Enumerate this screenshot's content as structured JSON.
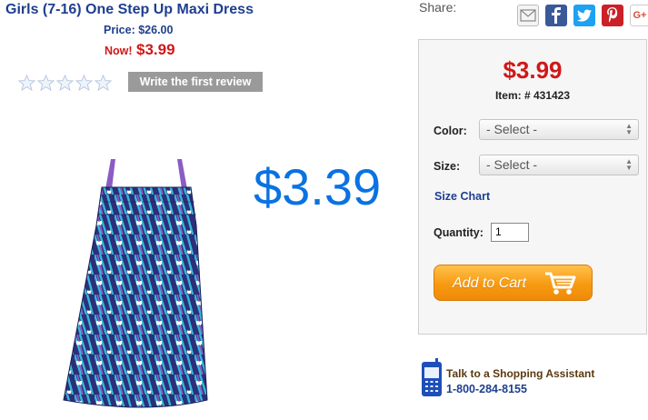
{
  "product": {
    "title": "Girls (7-16) One Step Up Maxi Dress",
    "price_label": "Price: $26.00",
    "now_label": "Now!",
    "now_price": "$3.99",
    "rating": 0,
    "review_button": "Write the first review",
    "overlay_price": "$3.39"
  },
  "share": {
    "label": "Share:",
    "icons": [
      "email-icon",
      "facebook-icon",
      "twitter-icon",
      "pinterest-icon",
      "google-plus-icon"
    ]
  },
  "panel": {
    "price": "$3.99",
    "item_number": "Item: # 431423",
    "color_label": "Color:",
    "color_value": "- Select -",
    "size_label": "Size:",
    "size_value": "- Select -",
    "size_chart": "Size Chart",
    "quantity_label": "Quantity:",
    "quantity_value": "1",
    "add_to_cart": "Add to Cart"
  },
  "assistant": {
    "text": "Talk to a Shopping Assistant",
    "phone": "1-800-284-8155"
  },
  "colors": {
    "title_blue": "#1e3f8f",
    "sale_red": "#d01818",
    "overlay_blue": "#0a72e2",
    "cart_orange": "#f79a12"
  }
}
